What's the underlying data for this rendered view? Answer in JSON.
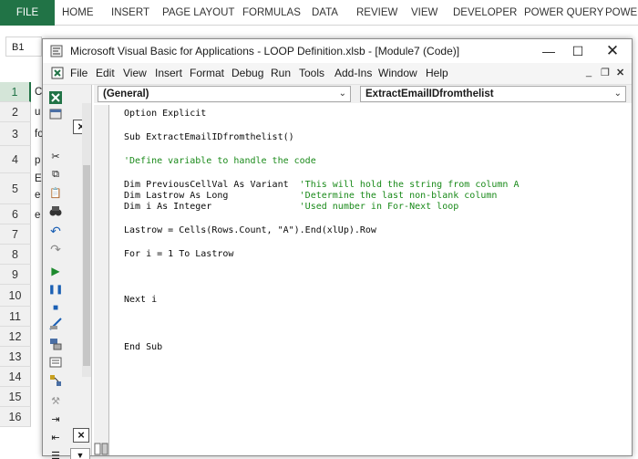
{
  "excel": {
    "file_tab": "FILE",
    "ribbon_tabs": [
      "HOME",
      "INSERT",
      "PAGE LAYOUT",
      "FORMULAS",
      "DATA",
      "REVIEW",
      "VIEW",
      "DEVELOPER",
      "POWER QUERY",
      "POWE"
    ],
    "namebox": "B1",
    "row_numbers": [
      "1",
      "2",
      "3",
      "4",
      "5",
      "6",
      "7",
      "8",
      "9",
      "10",
      "11",
      "12",
      "13",
      "14",
      "15",
      "16"
    ],
    "cell_peeks": [
      "C",
      "u",
      "fo",
      "p",
      "E",
      "e",
      "e"
    ]
  },
  "vbe": {
    "title": "Microsoft Visual Basic for Applications - LOOP Definition.xlsb - [Module7 (Code)]",
    "menus": [
      "File",
      "Edit",
      "View",
      "Insert",
      "Format",
      "Debug",
      "Run",
      "Tools",
      "Add-Ins",
      "Window",
      "Help"
    ],
    "object_combo": "(General)",
    "proc_combo": "ExtractEmailIDfromthelist",
    "code": {
      "l1": "Option Explicit",
      "l2": "Sub ExtractEmailIDfromthelist()",
      "l3": "'Define variable to handle the code",
      "l4a": "Dim PreviousCellVal As Variant  ",
      "l4b": "'This will hold the string from column A",
      "l5a": "Dim Lastrow As Long             ",
      "l5b": "'Determine the last non-blank column",
      "l6a": "Dim i As Integer                ",
      "l6b": "'Used number in For-Next loop",
      "l7": "Lastrow = Cells(Rows.Count, \"A\").End(xlUp).Row",
      "l8": "For i = 1 To Lastrow",
      "l9": "Next i",
      "l10": "End Sub"
    }
  }
}
